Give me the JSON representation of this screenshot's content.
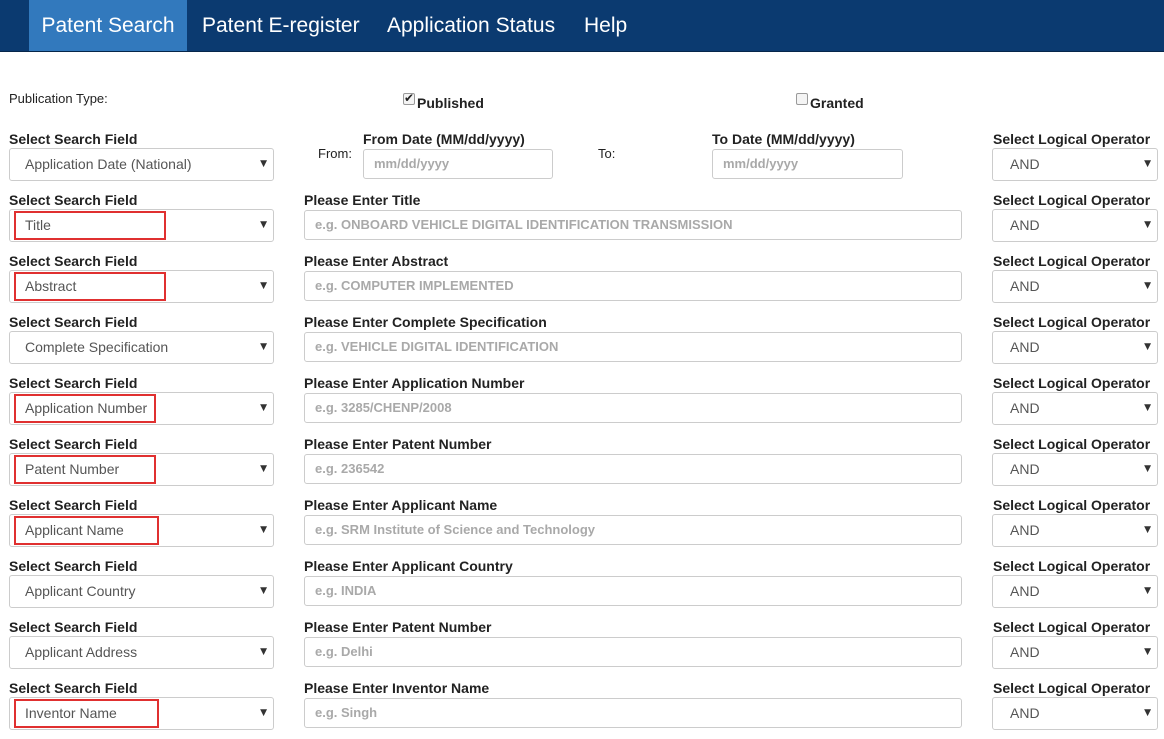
{
  "nav": {
    "items": [
      {
        "label": "Patent Search",
        "active": true
      },
      {
        "label": "Patent E-register",
        "active": false
      },
      {
        "label": "Application Status",
        "active": false
      },
      {
        "label": "Help",
        "active": false
      }
    ]
  },
  "publication": {
    "label": "Publication Type:",
    "published_label": "Published",
    "published_checked": true,
    "granted_label": "Granted",
    "granted_checked": false
  },
  "date_row": {
    "field_label": "Select Search Field",
    "field_value": "Application Date (National)",
    "from_label": "From:",
    "from_header": "From Date (MM/dd/yyyy)",
    "from_placeholder": "mm/dd/yyyy",
    "to_label": "To:",
    "to_header": "To Date (MM/dd/yyyy)",
    "to_placeholder": "mm/dd/yyyy",
    "operator_label": "Select Logical Operator",
    "operator_value": "AND"
  },
  "rows": [
    {
      "field_label": "Select Search Field",
      "field_value": "Title",
      "input_label": "Please Enter Title",
      "placeholder": "e.g. ONBOARD VEHICLE DIGITAL IDENTIFICATION TRANSMISSION",
      "operator_label": "Select Logical Operator",
      "operator_value": "AND",
      "highlighted": true
    },
    {
      "field_label": "Select Search Field",
      "field_value": "Abstract",
      "input_label": "Please Enter Abstract",
      "placeholder": "e.g. COMPUTER IMPLEMENTED",
      "operator_label": "Select Logical Operator",
      "operator_value": "AND",
      "highlighted": true
    },
    {
      "field_label": "Select Search Field",
      "field_value": "Complete Specification",
      "input_label": "Please Enter Complete Specification",
      "placeholder": "e.g.  VEHICLE DIGITAL IDENTIFICATION",
      "operator_label": "Select Logical Operator",
      "operator_value": "AND",
      "highlighted": false
    },
    {
      "field_label": "Select Search Field",
      "field_value": "Application Number",
      "input_label": "Please Enter Application Number",
      "placeholder": "e.g. 3285/CHENP/2008",
      "operator_label": "Select Logical Operator",
      "operator_value": "AND",
      "highlighted": true
    },
    {
      "field_label": "Select Search Field",
      "field_value": "Patent Number",
      "input_label": "Please Enter Patent Number",
      "placeholder": "e.g. 236542",
      "operator_label": "Select Logical Operator",
      "operator_value": "AND",
      "highlighted": true
    },
    {
      "field_label": "Select Search Field",
      "field_value": "Applicant Name",
      "input_label": "Please Enter Applicant Name",
      "placeholder": "e.g. SRM Institute of Science and Technology",
      "operator_label": "Select Logical Operator",
      "operator_value": "AND",
      "highlighted": true
    },
    {
      "field_label": "Select Search Field",
      "field_value": "Applicant Country",
      "input_label": "Please Enter Applicant Country",
      "placeholder": "e.g. INDIA",
      "operator_label": "Select Logical Operator",
      "operator_value": "AND",
      "highlighted": false
    },
    {
      "field_label": "Select Search Field",
      "field_value": "Applicant Address",
      "input_label": "Please Enter Patent Number",
      "placeholder": "e.g. Delhi",
      "operator_label": "Select Logical Operator",
      "operator_value": "AND",
      "highlighted": false
    },
    {
      "field_label": "Select Search Field",
      "field_value": "Inventor Name",
      "input_label": "Please Enter Inventor Name",
      "placeholder": "e.g. Singh",
      "operator_label": "Select Logical Operator",
      "operator_value": "AND",
      "highlighted": true
    }
  ],
  "icons": {
    "dropdown": "chevron-down-icon",
    "check": "checkmark-icon"
  },
  "colors": {
    "navbar": "#0b3a70",
    "nav_active": "#3279bd",
    "highlight": "#e03030"
  }
}
